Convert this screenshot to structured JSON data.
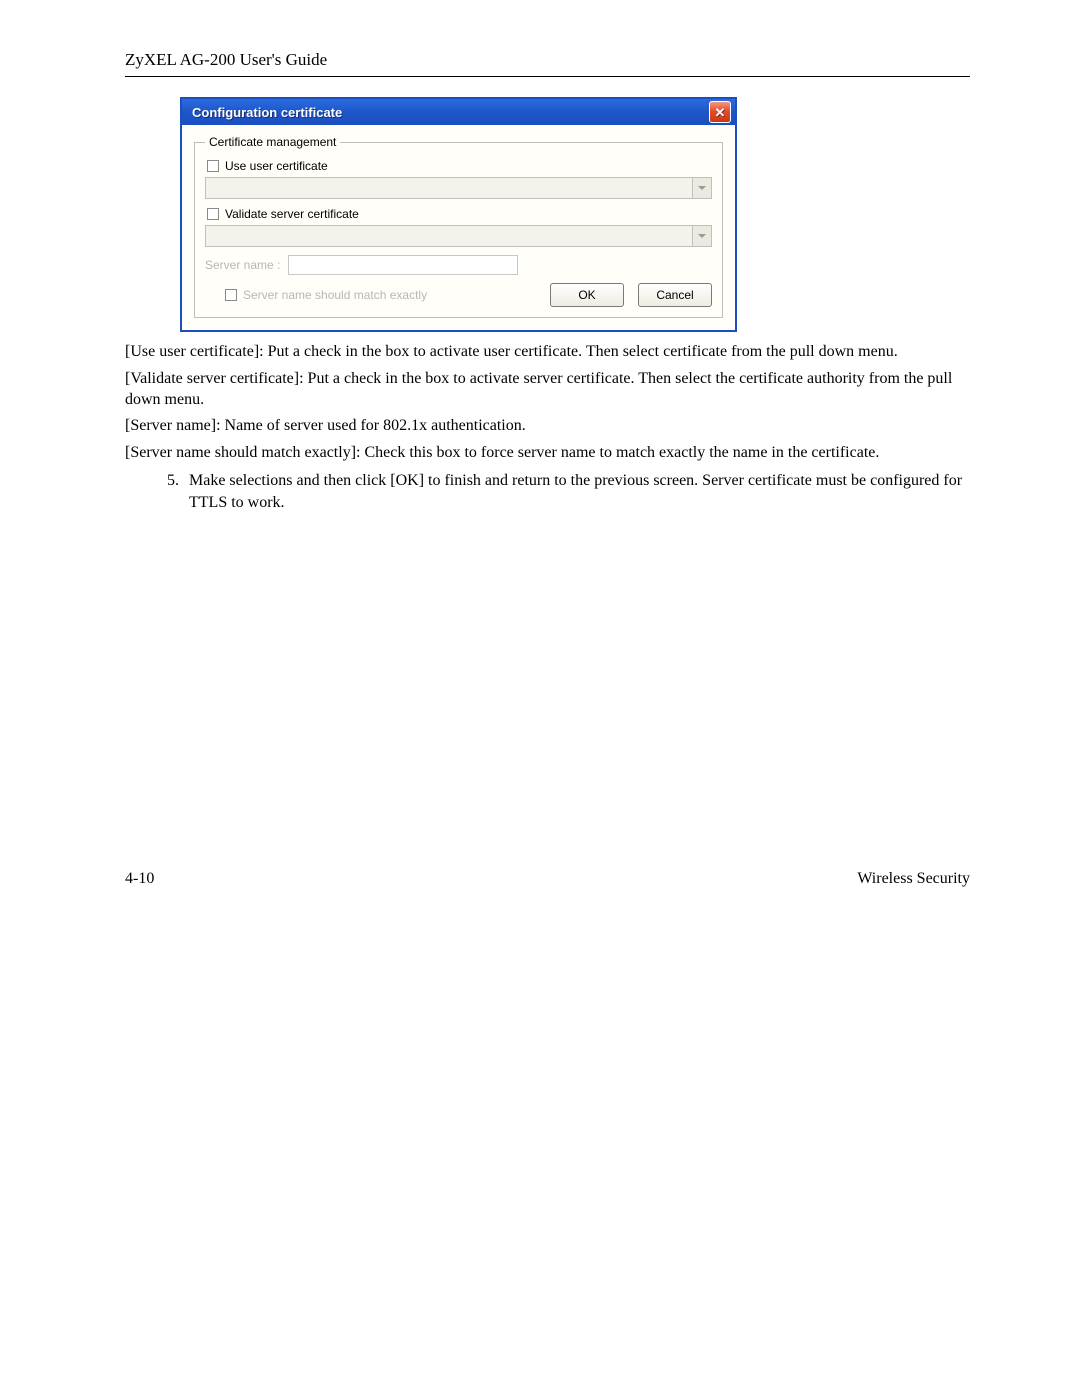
{
  "header": {
    "guide_title": "ZyXEL AG-200 User's Guide"
  },
  "dialog": {
    "title": "Configuration certificate",
    "group_legend": "Certificate management",
    "use_user_cert_label": "Use user certificate",
    "validate_server_cert_label": "Validate server certificate",
    "server_name_label": "Server name :",
    "match_exactly_label": "Server name should match exactly",
    "ok_label": "OK",
    "cancel_label": "Cancel"
  },
  "body": {
    "p1": "[Use user certificate]: Put a check in the box to activate user certificate.  Then select certificate from the pull down menu.",
    "p2": "[Validate server certificate]: Put a check in the box to activate server certificate.  Then select the certificate authority from the pull down menu.",
    "p3": "[Server name]: Name of server used for 802.1x authentication.",
    "p4": "[Server name should match exactly]: Check this box to force server name to match exactly the name in the certificate.",
    "step5": "Make selections and then click [OK] to finish and return to the previous screen.  Server certificate must be configured for TTLS to work."
  },
  "footer": {
    "page_number": "4-10",
    "section": "Wireless Security"
  }
}
